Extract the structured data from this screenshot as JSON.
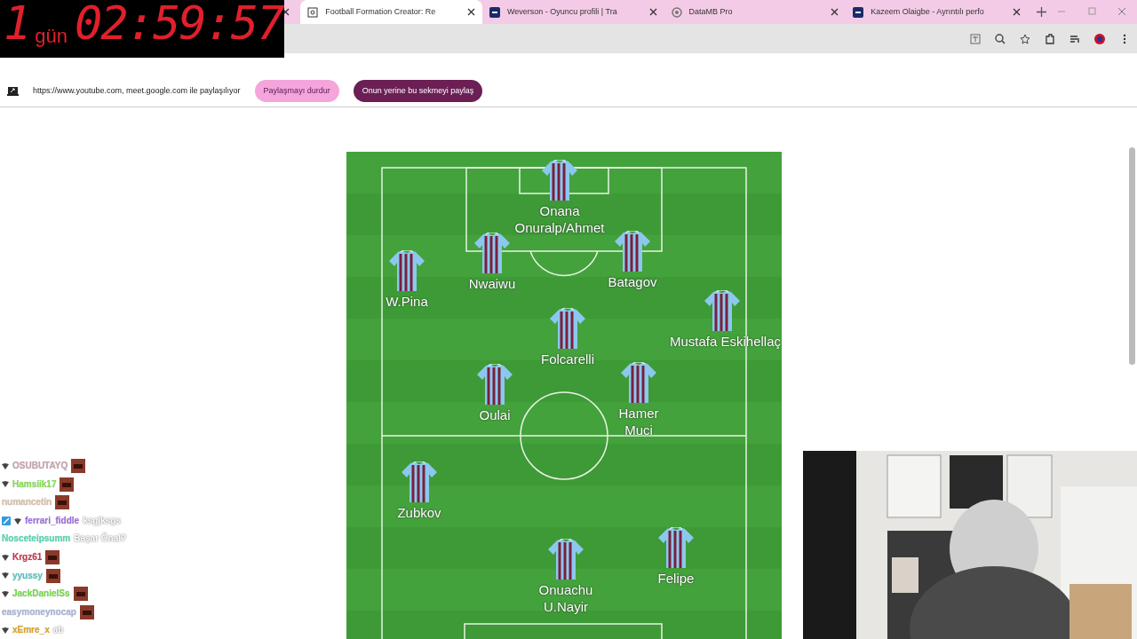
{
  "timer": {
    "days": "1",
    "unit": "gün",
    "time": "02:59:57"
  },
  "tabs": [
    {
      "title": "Football Formation Creator: Re",
      "selected": true
    },
    {
      "title": "Weverson - Oyuncu profili | Tra",
      "selected": false
    },
    {
      "title": "DataMB Pro",
      "selected": false
    },
    {
      "title": "Kazeem Olaigbe - Ayrıntılı perfo",
      "selected": false
    }
  ],
  "share_bar": {
    "message": "https://www.youtube.com, meet.google.com ile paylaşılıyor",
    "stop_button": "Paylaşmayı durdur",
    "share_button": "Onun yerine bu sekmeyi paylaş"
  },
  "players": [
    {
      "lines": [
        "Onana",
        "Onuralp/Ahmet"
      ]
    },
    {
      "lines": [
        "Nwaiwu"
      ]
    },
    {
      "lines": [
        "Batagov"
      ]
    },
    {
      "lines": [
        "W.Pina"
      ]
    },
    {
      "lines": [
        "Mustafa Eskihellaç"
      ]
    },
    {
      "lines": [
        "Folcarelli"
      ]
    },
    {
      "lines": [
        "Oulai"
      ]
    },
    {
      "lines": [
        "Hamer",
        "Muci"
      ]
    },
    {
      "lines": [
        "Zubkov"
      ]
    },
    {
      "lines": [
        "Onuachu",
        "U.Nayir"
      ]
    },
    {
      "lines": [
        "Felipe"
      ]
    }
  ],
  "chat": [
    {
      "user": "OSUBUTAYQ",
      "color": "#c9a3b0",
      "badge": true
    },
    {
      "user": "Hamsiik17",
      "color": "#7ee04a",
      "badge": true
    },
    {
      "user": "numancetin",
      "color": "#d8c0a8",
      "badge": false
    },
    {
      "user": "ferrari_fiddle",
      "color": "#9a6be0",
      "badge": true,
      "mod": true,
      "message": "ksgjksgs"
    },
    {
      "user": "Nosceteipsumm",
      "color": "#4ed6b0",
      "badge": false,
      "message": "Başar Önal?"
    },
    {
      "user": "Krgz61",
      "color": "#d0304a",
      "badge": true
    },
    {
      "user": "yyussy",
      "color": "#4ec8c0",
      "badge": true
    },
    {
      "user": "JackDanielSs",
      "color": "#70dc40",
      "badge": true
    },
    {
      "user": "easymoneynocap",
      "color": "#a8b4d8",
      "badge": false
    },
    {
      "user": "xEmre_x",
      "color": "#e0a020",
      "badge": true,
      "message": "ab"
    }
  ]
}
